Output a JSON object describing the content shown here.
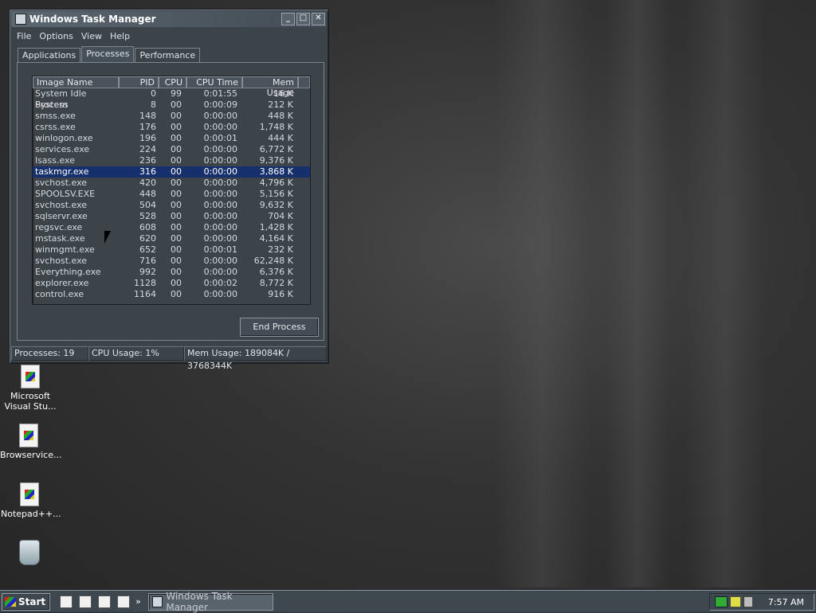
{
  "window": {
    "title": "Windows Task Manager",
    "controls": {
      "minimize": "_",
      "maximize": "□",
      "close": "✕"
    },
    "menu": [
      "File",
      "Options",
      "View",
      "Help"
    ],
    "tabs": [
      {
        "label": "Applications",
        "active": false
      },
      {
        "label": "Processes",
        "active": true
      },
      {
        "label": "Performance",
        "active": false
      }
    ],
    "columns": [
      "Image Name",
      "PID",
      "CPU",
      "CPU Time",
      "Mem Usage"
    ],
    "processes": [
      {
        "name": "System Idle Process",
        "pid": "0",
        "cpu": "99",
        "time": "0:01:55",
        "mem": "16 K"
      },
      {
        "name": "System",
        "pid": "8",
        "cpu": "00",
        "time": "0:00:09",
        "mem": "212 K"
      },
      {
        "name": "smss.exe",
        "pid": "148",
        "cpu": "00",
        "time": "0:00:00",
        "mem": "448 K"
      },
      {
        "name": "csrss.exe",
        "pid": "176",
        "cpu": "00",
        "time": "0:00:00",
        "mem": "1,748 K"
      },
      {
        "name": "winlogon.exe",
        "pid": "196",
        "cpu": "00",
        "time": "0:00:01",
        "mem": "444 K"
      },
      {
        "name": "services.exe",
        "pid": "224",
        "cpu": "00",
        "time": "0:00:00",
        "mem": "6,772 K"
      },
      {
        "name": "lsass.exe",
        "pid": "236",
        "cpu": "00",
        "time": "0:00:00",
        "mem": "9,376 K"
      },
      {
        "name": "taskmgr.exe",
        "pid": "316",
        "cpu": "00",
        "time": "0:00:00",
        "mem": "3,868 K",
        "selected": true
      },
      {
        "name": "svchost.exe",
        "pid": "420",
        "cpu": "00",
        "time": "0:00:00",
        "mem": "4,796 K"
      },
      {
        "name": "SPOOLSV.EXE",
        "pid": "448",
        "cpu": "00",
        "time": "0:00:00",
        "mem": "5,156 K"
      },
      {
        "name": "svchost.exe",
        "pid": "504",
        "cpu": "00",
        "time": "0:00:00",
        "mem": "9,632 K"
      },
      {
        "name": "sqlservr.exe",
        "pid": "528",
        "cpu": "00",
        "time": "0:00:00",
        "mem": "704 K"
      },
      {
        "name": "regsvc.exe",
        "pid": "608",
        "cpu": "00",
        "time": "0:00:00",
        "mem": "1,428 K"
      },
      {
        "name": "mstask.exe",
        "pid": "620",
        "cpu": "00",
        "time": "0:00:00",
        "mem": "4,164 K"
      },
      {
        "name": "winmgmt.exe",
        "pid": "652",
        "cpu": "00",
        "time": "0:00:01",
        "mem": "232 K"
      },
      {
        "name": "svchost.exe",
        "pid": "716",
        "cpu": "00",
        "time": "0:00:00",
        "mem": "62,248 K"
      },
      {
        "name": "Everything.exe",
        "pid": "992",
        "cpu": "00",
        "time": "0:00:00",
        "mem": "6,376 K"
      },
      {
        "name": "explorer.exe",
        "pid": "1128",
        "cpu": "00",
        "time": "0:00:02",
        "mem": "8,772 K"
      },
      {
        "name": "control.exe",
        "pid": "1164",
        "cpu": "00",
        "time": "0:00:00",
        "mem": "916 K"
      }
    ],
    "end_process_label": "End Process",
    "status": {
      "processes": "Processes: 19",
      "cpu": "CPU Usage: 1%",
      "mem": "Mem Usage: 189084K / 3768344K"
    },
    "selected_color": "#16306e"
  },
  "desktop_icons": [
    {
      "label": "Microsoft Visual Stu...",
      "icon": "application-icon"
    },
    {
      "label": "Browservice...",
      "icon": "application-icon"
    },
    {
      "label": "Notepad++...",
      "icon": "application-icon"
    },
    {
      "label": "",
      "icon": "recycle-bin-icon"
    }
  ],
  "taskbar": {
    "start_label": "Start",
    "task_button": "Windows Task Manager",
    "clock": "7:57 AM",
    "quick_launch_more": "»"
  }
}
